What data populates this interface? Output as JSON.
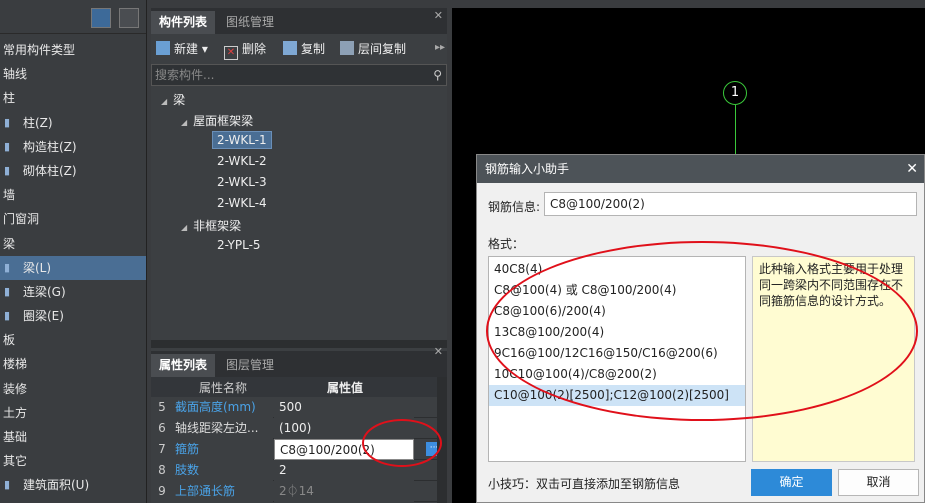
{
  "left_panel": {
    "items": [
      {
        "label": "常用构件类型",
        "sub": false,
        "selected": false,
        "icon": ""
      },
      {
        "label": "轴线",
        "sub": false,
        "selected": false,
        "icon": ""
      },
      {
        "label": "柱",
        "sub": false,
        "selected": false,
        "icon": ""
      },
      {
        "label": "柱(Z)",
        "sub": true,
        "selected": false,
        "icon": "column-icon"
      },
      {
        "label": "构造柱(Z)",
        "sub": true,
        "selected": false,
        "icon": "constructional-column-icon"
      },
      {
        "label": "砌体柱(Z)",
        "sub": true,
        "selected": false,
        "icon": "masonry-column-icon"
      },
      {
        "label": "墙",
        "sub": false,
        "selected": false,
        "icon": ""
      },
      {
        "label": "门窗洞",
        "sub": false,
        "selected": false,
        "icon": ""
      },
      {
        "label": "梁",
        "sub": false,
        "selected": false,
        "icon": ""
      },
      {
        "label": "梁(L)",
        "sub": true,
        "selected": true,
        "icon": "beam-icon"
      },
      {
        "label": "连梁(G)",
        "sub": true,
        "selected": false,
        "icon": "coupling-beam-icon"
      },
      {
        "label": "圈梁(E)",
        "sub": true,
        "selected": false,
        "icon": "ring-beam-icon"
      },
      {
        "label": "板",
        "sub": false,
        "selected": false,
        "icon": ""
      },
      {
        "label": "楼梯",
        "sub": false,
        "selected": false,
        "icon": ""
      },
      {
        "label": "装修",
        "sub": false,
        "selected": false,
        "icon": ""
      },
      {
        "label": "土方",
        "sub": false,
        "selected": false,
        "icon": ""
      },
      {
        "label": "基础",
        "sub": false,
        "selected": false,
        "icon": ""
      },
      {
        "label": "其它",
        "sub": false,
        "selected": false,
        "icon": ""
      },
      {
        "label": "建筑面积(U)",
        "sub": true,
        "selected": false,
        "icon": "building-area-icon"
      }
    ]
  },
  "component_panel": {
    "tabs": [
      "构件列表",
      "图纸管理"
    ],
    "toolbar": {
      "new": "新建",
      "delete": "删除",
      "copy": "复制",
      "floor_copy": "层间复制"
    },
    "search_placeholder": "搜索构件...",
    "tree": {
      "root": "梁",
      "group1": "屋面框架梁",
      "group1_items": [
        "2-WKL-1",
        "2-WKL-2",
        "2-WKL-3",
        "2-WKL-4"
      ],
      "group2": "非框架梁",
      "group2_items": [
        "2-YPL-5"
      ]
    }
  },
  "property_panel": {
    "tabs": [
      "属性列表",
      "图层管理"
    ],
    "header_name": "属性名称",
    "header_value": "属性值",
    "rows": [
      {
        "num": "5",
        "name": "截面高度(mm)",
        "value": "500"
      },
      {
        "num": "6",
        "name": "轴线距梁左边...",
        "value": "(100)"
      },
      {
        "num": "7",
        "name": "箍筋",
        "value": "C8@100/200(2)"
      },
      {
        "num": "8",
        "name": "肢数",
        "value": "2"
      },
      {
        "num": "9",
        "name": "上部通长筋",
        "value": "2⏀14"
      }
    ]
  },
  "canvas": {
    "axis_label": "1"
  },
  "dialog": {
    "title": "钢筋输入小助手",
    "rebar_label": "钢筋信息:",
    "rebar_value": "C8@100/200(2)",
    "format_label": "格式：",
    "formats": [
      "40C8(4)",
      "C8@100(4) 或 C8@100/200(4)",
      "C8@100(6)/200(4)",
      "13C8@100/200(4)",
      "9C16@100/12C16@150/C16@200(6)",
      "10C10@100(4)/C8@200(2)",
      "C10@100(2)[2500];C12@100(2)[2500]"
    ],
    "selected_format_index": 6,
    "help_text": "此种输入格式主要用于处理同一跨梁内不同范围存在不同箍筋信息的设计方式。",
    "tip": "小技巧：双击可直接添加至钢筋信息",
    "ok": "确定",
    "cancel": "取消"
  },
  "colors": {
    "selection": "#4a6e94",
    "highlight_text": "#4aa3e8",
    "primary_button": "#2d8ad8",
    "annotation_ring": "#e0101a"
  }
}
